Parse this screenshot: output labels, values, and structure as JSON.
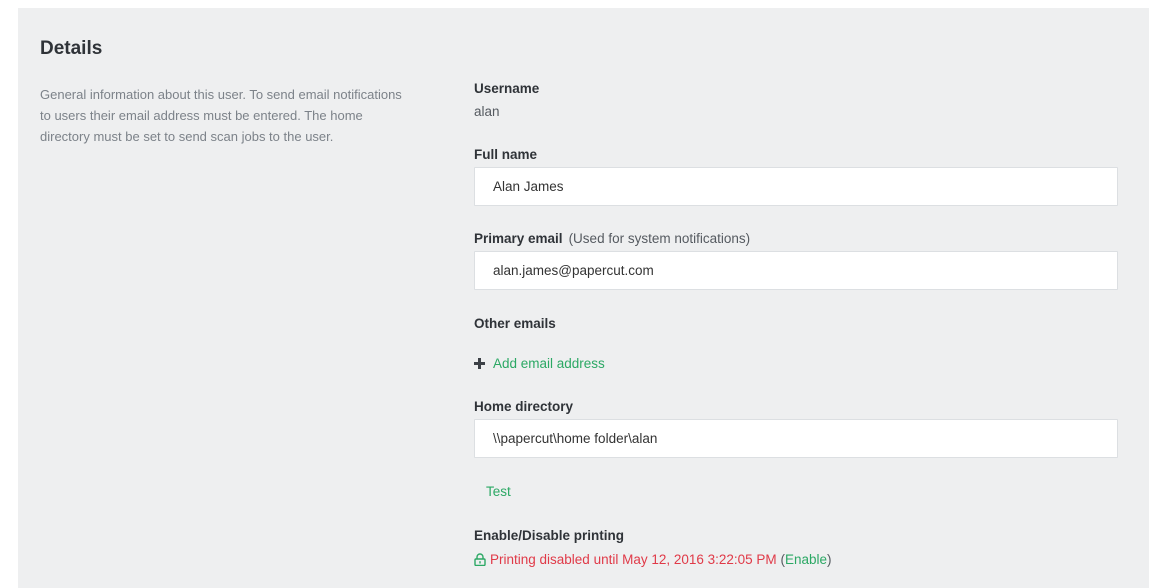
{
  "section": {
    "title": "Details",
    "description": "General information about this user. To send email notifications to users their email address must be entered. The home directory must be set to send scan jobs to the user."
  },
  "username": {
    "label": "Username",
    "value": "alan"
  },
  "full_name": {
    "label": "Full name",
    "value": "Alan James"
  },
  "primary_email": {
    "label": "Primary email",
    "hint": "(Used for system notifications)",
    "value": "alan.james@papercut.com"
  },
  "other_emails": {
    "label": "Other emails",
    "add_link": "Add email address"
  },
  "home_directory": {
    "label": "Home directory",
    "value": "\\\\papercut\\home folder\\alan",
    "test_link": "Test"
  },
  "printing": {
    "label": "Enable/Disable printing",
    "status_text": "Printing disabled until May 12, 2016 3:22:05 PM",
    "paren_open": "(",
    "enable_link": "Enable",
    "paren_close": ")"
  },
  "colors": {
    "panel_bg": "#eeeff0",
    "accent_green": "#2ba864",
    "alert_red": "#e03a48"
  },
  "icons": {
    "add": "plus-icon",
    "status": "lock-icon"
  }
}
